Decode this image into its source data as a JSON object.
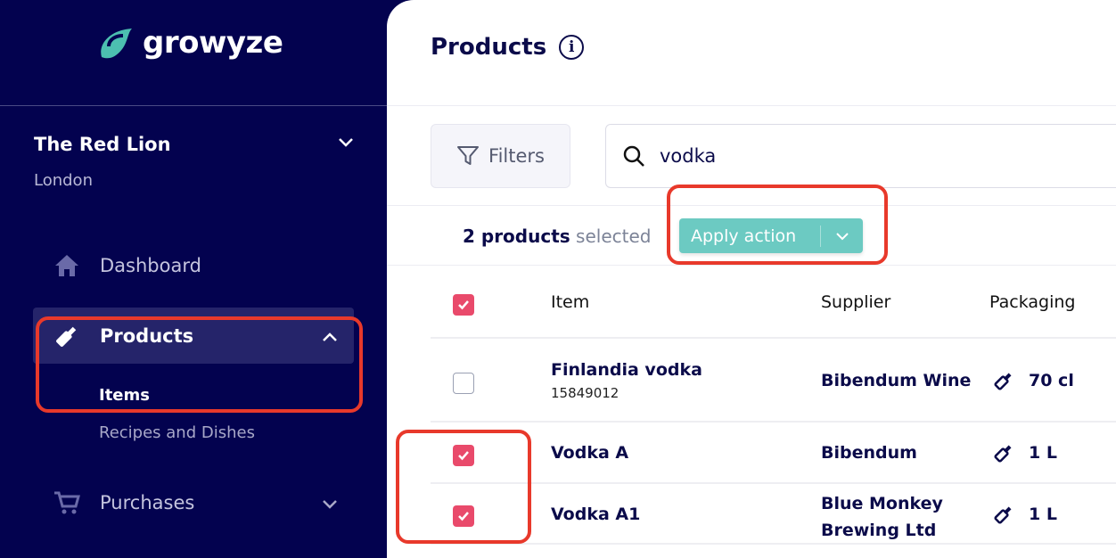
{
  "sidebar": {
    "logo_text": "growyze",
    "venue": "The Red Lion",
    "city": "London",
    "nav": [
      {
        "label": "Dashboard",
        "icon": "home-icon"
      },
      {
        "label": "Products",
        "icon": "bottle-icon",
        "active": true,
        "sub": [
          {
            "label": "Items",
            "active": true
          },
          {
            "label": "Recipes and Dishes"
          }
        ]
      },
      {
        "label": "Purchases",
        "icon": "cart-icon"
      }
    ]
  },
  "main": {
    "title": "Products",
    "filters_label": "Filters",
    "search_value": "vodka",
    "selected_count": "2 products",
    "selected_suffix": "selected",
    "apply_action_label": "Apply action",
    "columns": [
      "Item",
      "Supplier",
      "Packaging"
    ],
    "rows": [
      {
        "name": "Finlandia vodka",
        "code": "15849012",
        "supplier": "Bibendum Wine",
        "packaging": "70 cl",
        "checked": false
      },
      {
        "name": "Vodka A",
        "code": "",
        "supplier": "Bibendum",
        "packaging": "1 L",
        "checked": true
      },
      {
        "name": "Vodka A1",
        "code": "",
        "supplier": "Blue Monkey Brewing Ltd",
        "packaging": "1 L",
        "checked": true
      }
    ]
  },
  "colors": {
    "sidebar": "#03024f",
    "accent": "#6ccac2",
    "checkbox": "#e94a6b",
    "annotation": "#e8392b"
  }
}
